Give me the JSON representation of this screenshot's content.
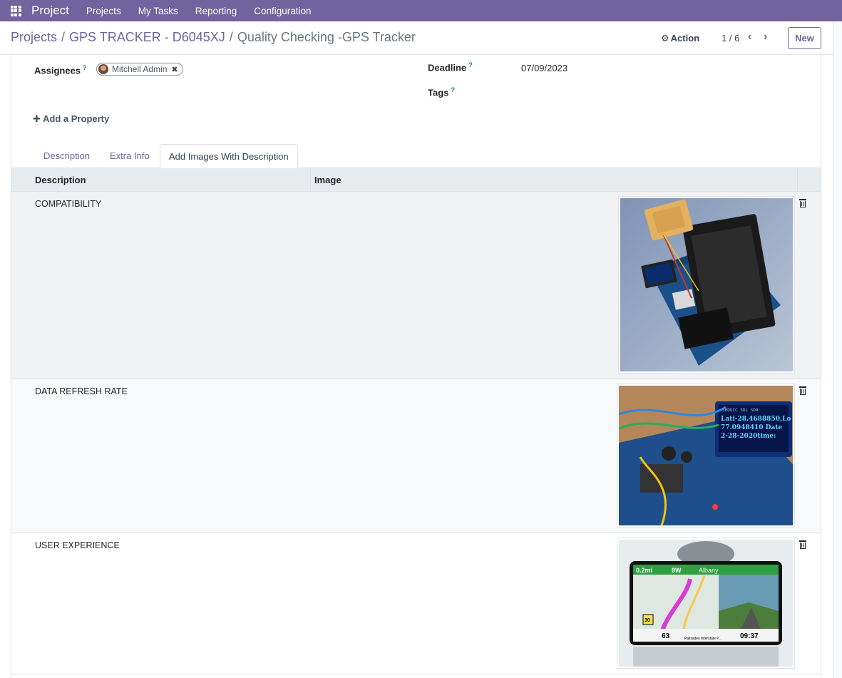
{
  "navbar": {
    "brand": "Project",
    "items": [
      "Projects",
      "My Tasks",
      "Reporting",
      "Configuration"
    ]
  },
  "breadcrumb": {
    "root": "Projects",
    "project": "GPS TRACKER - D6045XJ",
    "current": "Quality Checking -GPS Tracker"
  },
  "control": {
    "action_label": "Action",
    "pager": "1 / 6",
    "new_label": "New"
  },
  "form": {
    "assignees_label": "Assignees",
    "assignee_name": "Mitchell Admin",
    "deadline_label": "Deadline",
    "deadline_value": "07/09/2023",
    "tags_label": "Tags",
    "help_marker": "?",
    "add_property": "Add a Property"
  },
  "tabs": [
    "Description",
    "Extra Info",
    "Add Images With Description"
  ],
  "table": {
    "columns": [
      "Description",
      "Image"
    ],
    "rows": [
      {
        "description": "COMPATIBILITY",
        "image": "gps-module-board-photo"
      },
      {
        "description": "DATA REFRESH RATE",
        "image": "arduino-oled-coordinates-photo"
      },
      {
        "description": "USER EXPERIENCE",
        "image": "car-gps-navigator-photo"
      }
    ]
  },
  "images": {
    "oled_lines": [
      "Lati-28.4688850,Lo",
      "77.0948410 Date",
      "2-28-2020time:"
    ],
    "oled_header": "SHDUCC SDL SDA",
    "nav_distance": "0.2mi",
    "nav_exit": "9W",
    "nav_destination": "Albany",
    "nav_speed_limit": "30",
    "nav_speed": "63",
    "nav_time": "09:37",
    "nav_street": "Palisades Interstate P..."
  },
  "colors": {
    "brand": "#71639e",
    "link": "#71639e",
    "help": "#017e84"
  }
}
